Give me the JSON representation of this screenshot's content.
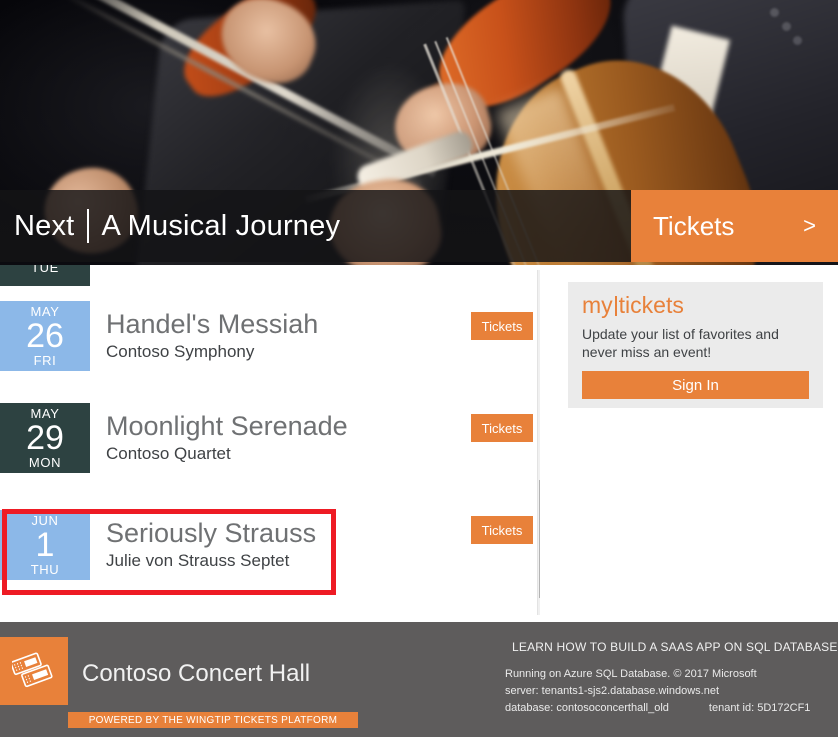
{
  "hero": {
    "next_label": "Next",
    "feature_title": "A Musical Journey",
    "tickets_label": "Tickets",
    "chevron": ">",
    "image_alt": "orchestra-string-players",
    "bar_color": "#141416",
    "accent_color": "#e8813a"
  },
  "events": {
    "partial_top": {
      "dow": "TUE",
      "card_color": "#2d4241"
    },
    "ticket_label": "Tickets",
    "items": [
      {
        "month": "MAY",
        "day": "26",
        "dow": "FRI",
        "title": "Handel's Messiah",
        "performer": "Contoso Symphony",
        "card_color": "#8cb8e8",
        "ticket_label": "Tickets",
        "highlighted": false
      },
      {
        "month": "MAY",
        "day": "29",
        "dow": "MON",
        "title": "Moonlight Serenade",
        "performer": "Contoso Quartet",
        "card_color": "#2d4241",
        "ticket_label": "Tickets",
        "highlighted": false
      },
      {
        "month": "JUN",
        "day": "1",
        "dow": "THU",
        "title": "Seriously Strauss",
        "performer": "Julie von Strauss Septet",
        "card_color": "#8cb8e8",
        "ticket_label": "Tickets",
        "highlighted": true,
        "highlight_color": "#ee1b24"
      }
    ]
  },
  "scrollbar": {
    "up_arrow": "▲",
    "down_arrow": "▼"
  },
  "mytickets": {
    "logo_first": "my",
    "logo_second": "tickets",
    "description": "Update your list of favorites and never miss an event!",
    "signin_label": "Sign In",
    "panel_color": "#ebebeb",
    "accent_color": "#e8813a"
  },
  "footer": {
    "brand": "Contoso Concert Hall",
    "logo_icon": "tickets-icon",
    "powered_by": "POWERED BY THE WINGTIP TICKETS PLATFORM",
    "learn_more": "LEARN HOW TO BUILD A SAAS APP ON SQL DATABASE",
    "running_on": "Running on Azure SQL Database. © 2017 Microsoft",
    "server": "server: tenants1-sjs2.database.windows.net",
    "database": "database: contosoconcerthall_old",
    "tenant_id": "tenant id: 5D172CF1",
    "background_color": "#5e5c5c"
  }
}
